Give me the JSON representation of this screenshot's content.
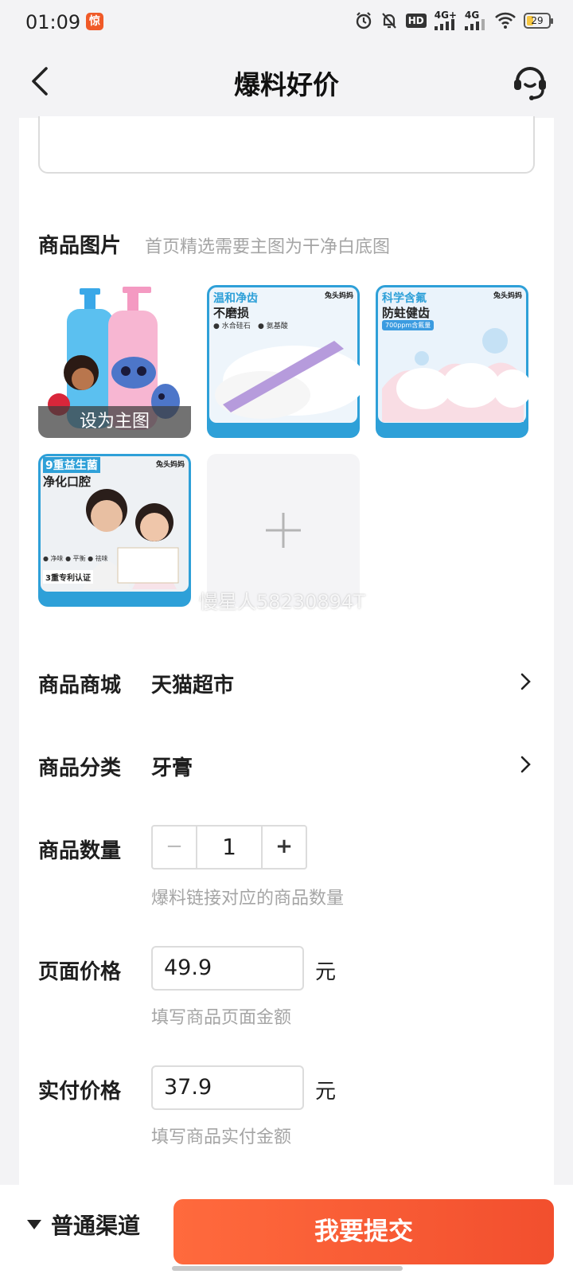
{
  "status_bar": {
    "time": "01:09",
    "app_badge": "惊",
    "battery": "29",
    "net_4g_plus": "4G+",
    "net_4g": "4G",
    "hd": "HD"
  },
  "header": {
    "title": "爆料好价"
  },
  "images": {
    "label": "商品图片",
    "hint": "首页精选需要主图为干净白底图",
    "set_main_label": "设为主图",
    "tile2": {
      "line1": "温和净齿",
      "line2": "不磨损",
      "tag1": "● 水合硅石",
      "tag2": "● 氨基酸"
    },
    "tile3": {
      "line1": "科学含氟",
      "line2": "防蛀健齿",
      "badge": "700ppm含氟量"
    },
    "tile4": {
      "line1": "9重益生菌",
      "line2": "净化口腔",
      "tags": "● 净味 ● 平衡 ● 祛味",
      "footer": "3重专利认证"
    },
    "brand_mark": "兔头妈妈",
    "add_symbol": "+",
    "watermark": "慢星人58230894T"
  },
  "mall": {
    "label": "商品商城",
    "value": "天猫超市"
  },
  "category": {
    "label": "商品分类",
    "value": "牙膏"
  },
  "quantity": {
    "label": "商品数量",
    "minus": "−",
    "value": "1",
    "plus": "+",
    "hint": "爆料链接对应的商品数量"
  },
  "page_price": {
    "label": "页面价格",
    "value": "49.9",
    "unit": "元",
    "hint": "填写商品页面金额"
  },
  "paid_price": {
    "label": "实付价格",
    "value": "37.9",
    "unit": "元",
    "hint": "填写商品实付金额"
  },
  "bottom": {
    "channel_label": "普通渠道",
    "submit_label": "我要提交"
  },
  "colors": {
    "accent": "#f24f2e",
    "accent_light": "#ff6a3d",
    "tile_blue": "#2ea0d8"
  }
}
